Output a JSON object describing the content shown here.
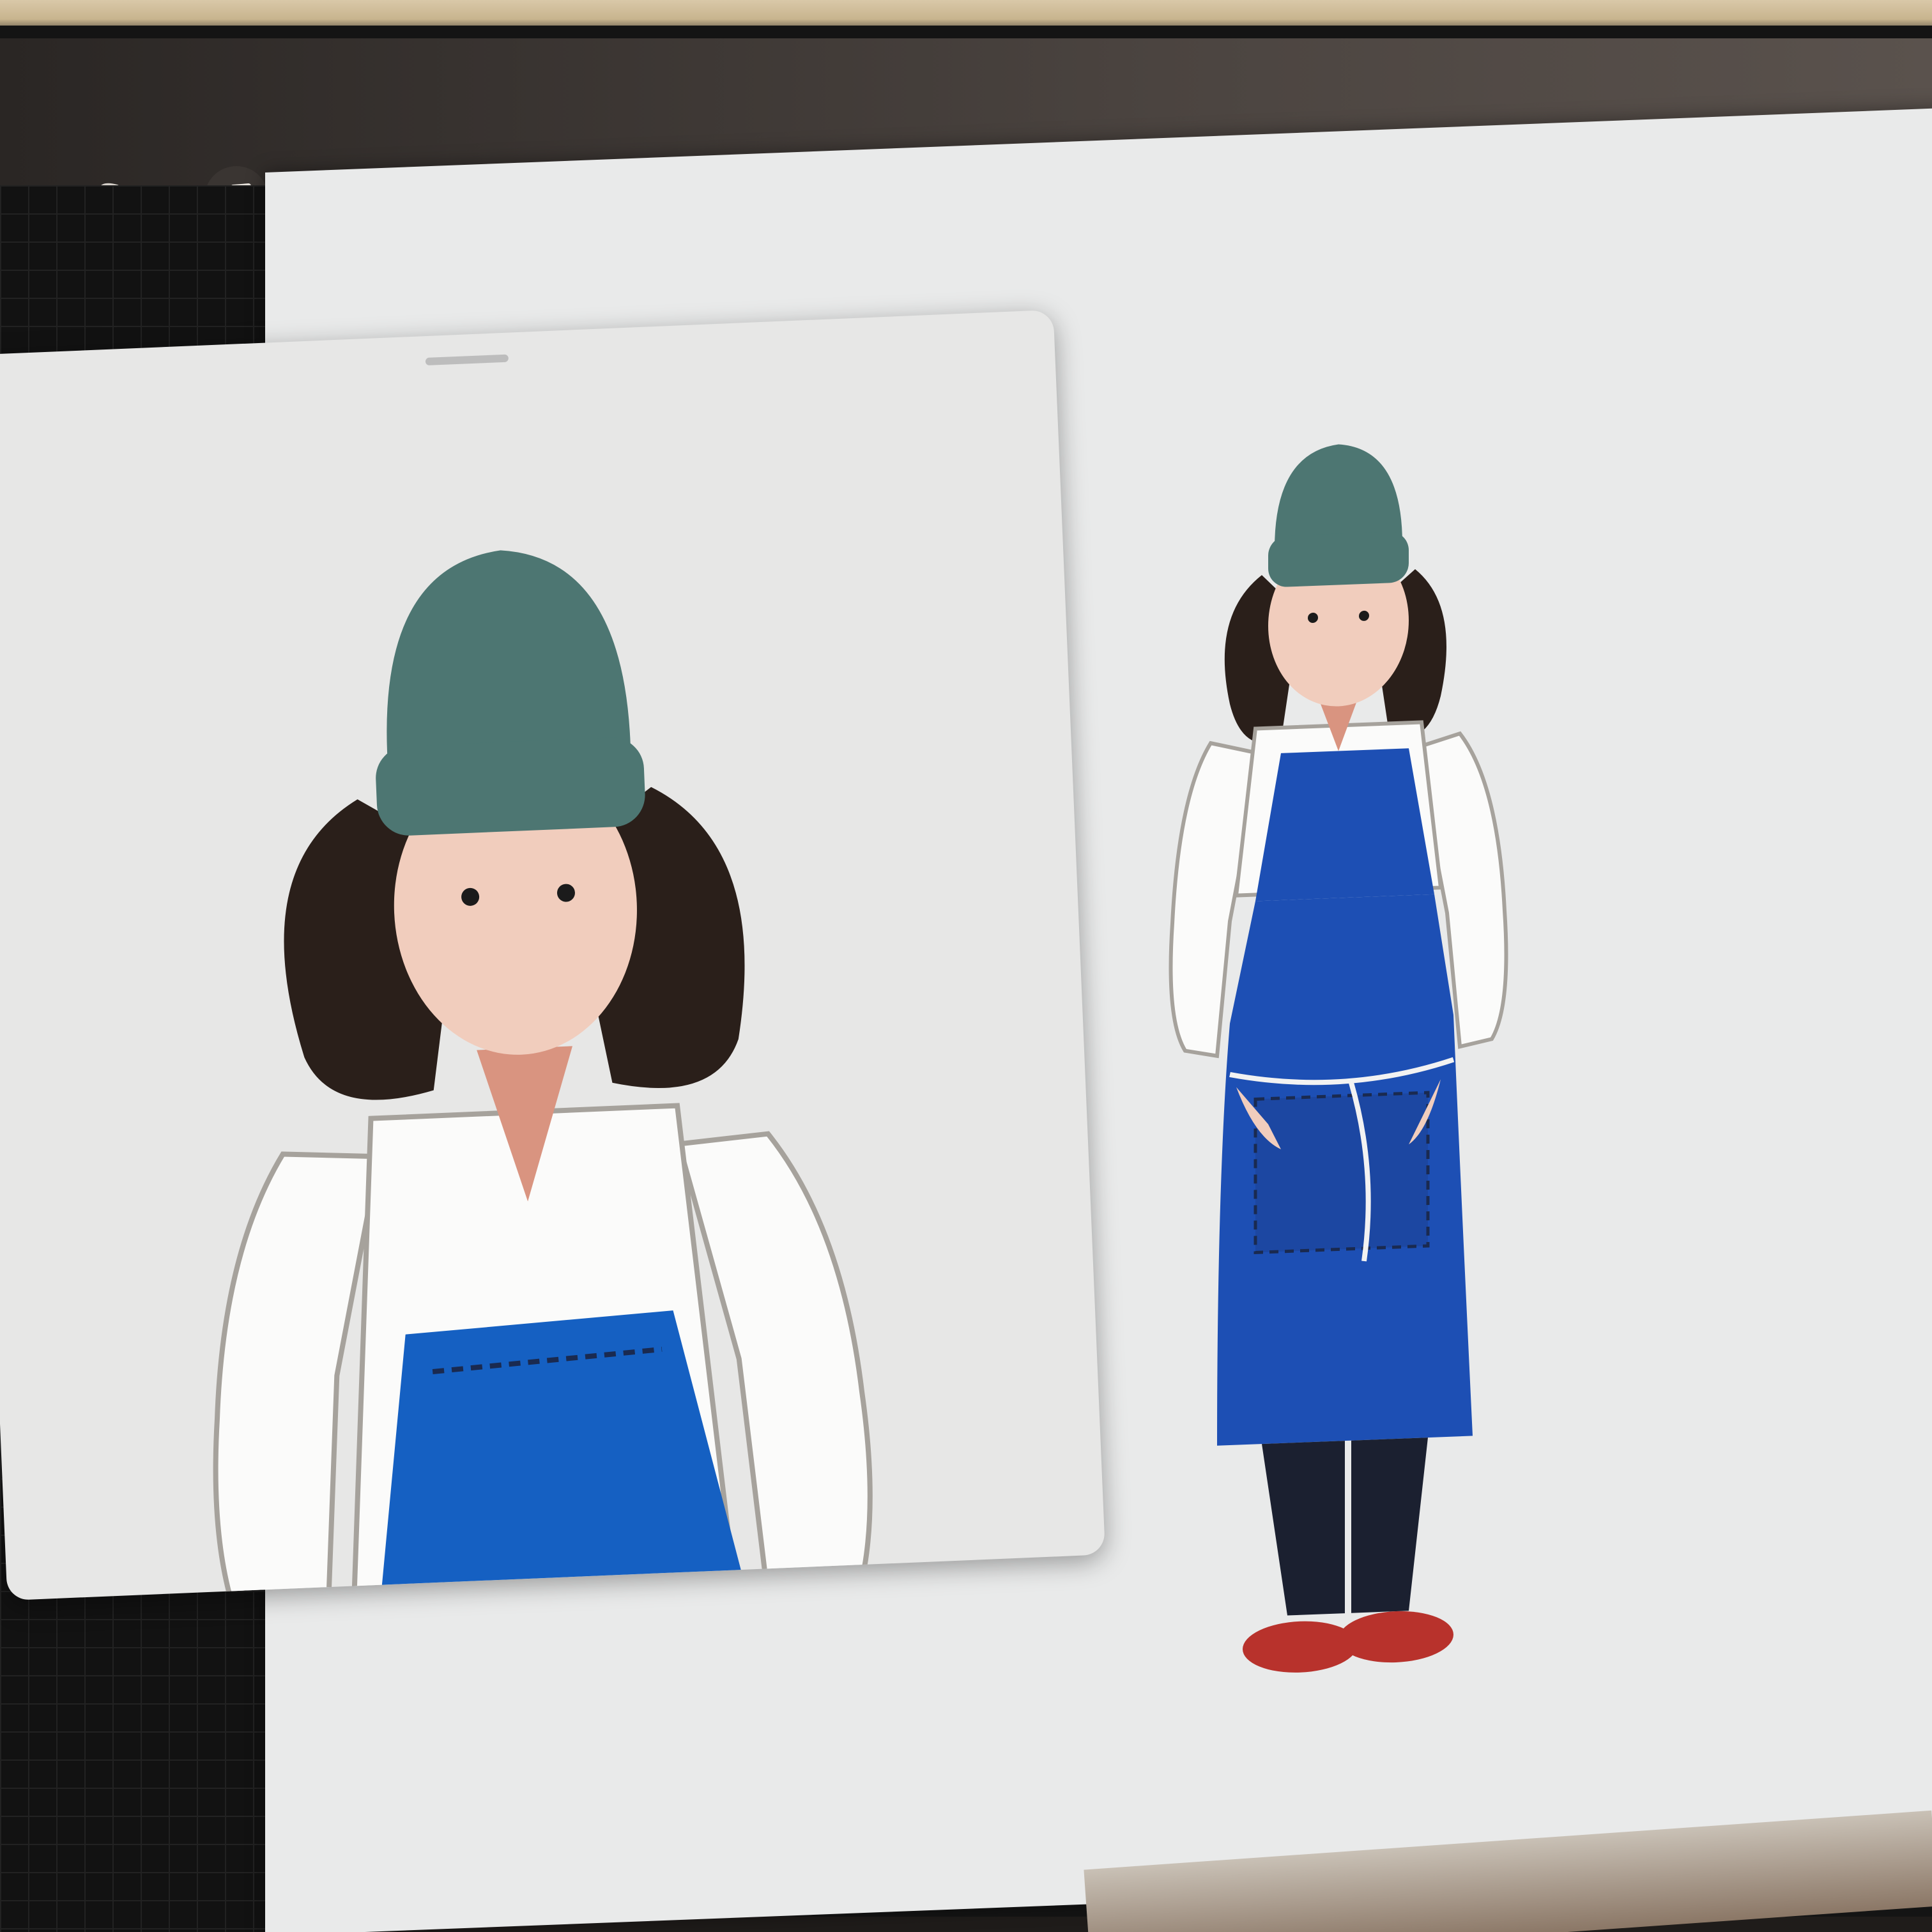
{
  "app": {
    "toolbar_left_icons": [
      "wrench-icon",
      "s-selection-icon",
      "arrow-transform-icon"
    ],
    "toolbar_right_icons": [
      "brush-icon",
      "smudge-icon"
    ]
  },
  "colors": {
    "beanie": "#4d7672",
    "hair": "#2a1f1a",
    "apron": "#1d4fb4",
    "apron_ref": "#1560c2",
    "shirt_line": "#a6a29c",
    "skin": "#f1cdbd",
    "neck": "#d99480",
    "pants": "#1b2030",
    "shoes": "#b8322c",
    "canvas": "#e9eaea"
  },
  "reference_window": {
    "content": "zoomed-illustration-of-woman-in-beanie-and-blue-apron"
  },
  "canvas": {
    "content": "full-body-illustration-of-woman-in-beanie-and-blue-apron"
  }
}
